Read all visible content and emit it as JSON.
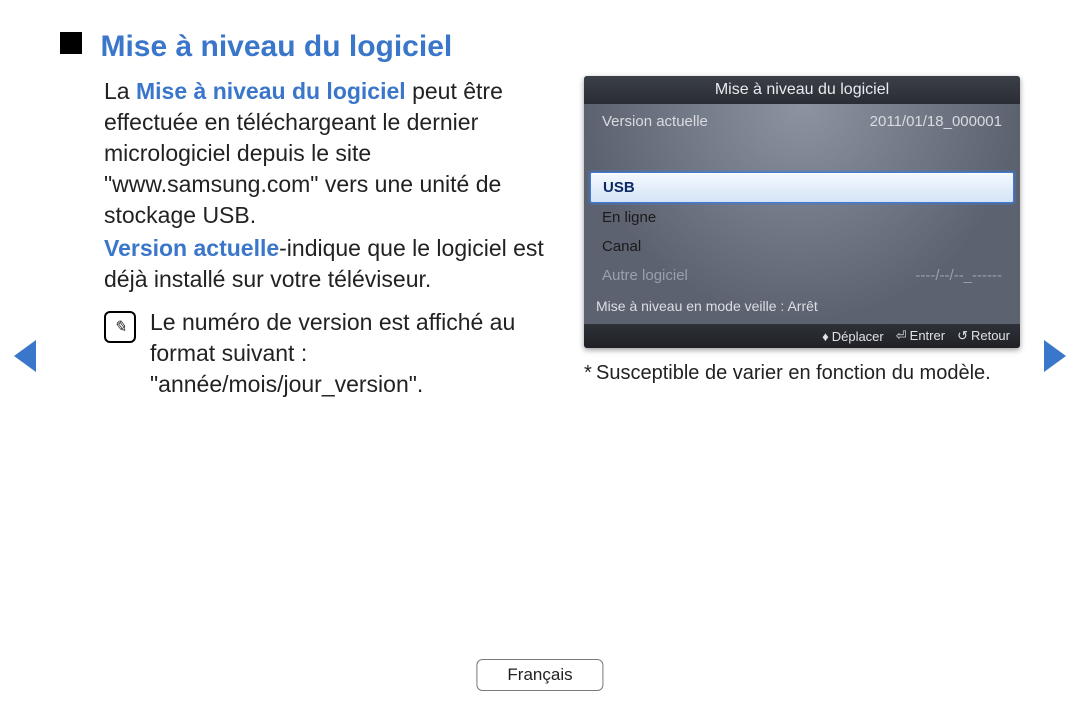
{
  "heading": "Mise à niveau du logiciel",
  "paragraph1": {
    "prefix": "La ",
    "bold": "Mise à niveau du logiciel",
    "rest": " peut être effectuée en téléchargeant le dernier micrologiciel depuis le site \"www.samsung.com\" vers une unité de stockage USB."
  },
  "paragraph2": {
    "bold": "Version actuelle",
    "rest": "-indique que le logiciel est déjà installé sur votre téléviseur."
  },
  "note": {
    "text": "Le numéro de version est affiché au format suivant : \"année/mois/jour_version\"."
  },
  "tv": {
    "title": "Mise à niveau du logiciel",
    "version_label": "Version actuelle",
    "version_value": "2011/01/18_000001",
    "options": {
      "usb": "USB",
      "online": "En ligne",
      "channel": "Canal",
      "other_label": "Autre logiciel",
      "other_value": "----/--/--_------"
    },
    "standby": "Mise à niveau en mode veille : Arrêt",
    "footer": {
      "move": "Déplacer",
      "enter": "Entrer",
      "return": "Retour"
    }
  },
  "caption": "Susceptible de varier en fonction du modèle.",
  "language": "Français",
  "icons": {
    "note_glyph": "✎",
    "updown": "♦",
    "enter": "⏎",
    "return": "↺",
    "asterisk": "*"
  }
}
